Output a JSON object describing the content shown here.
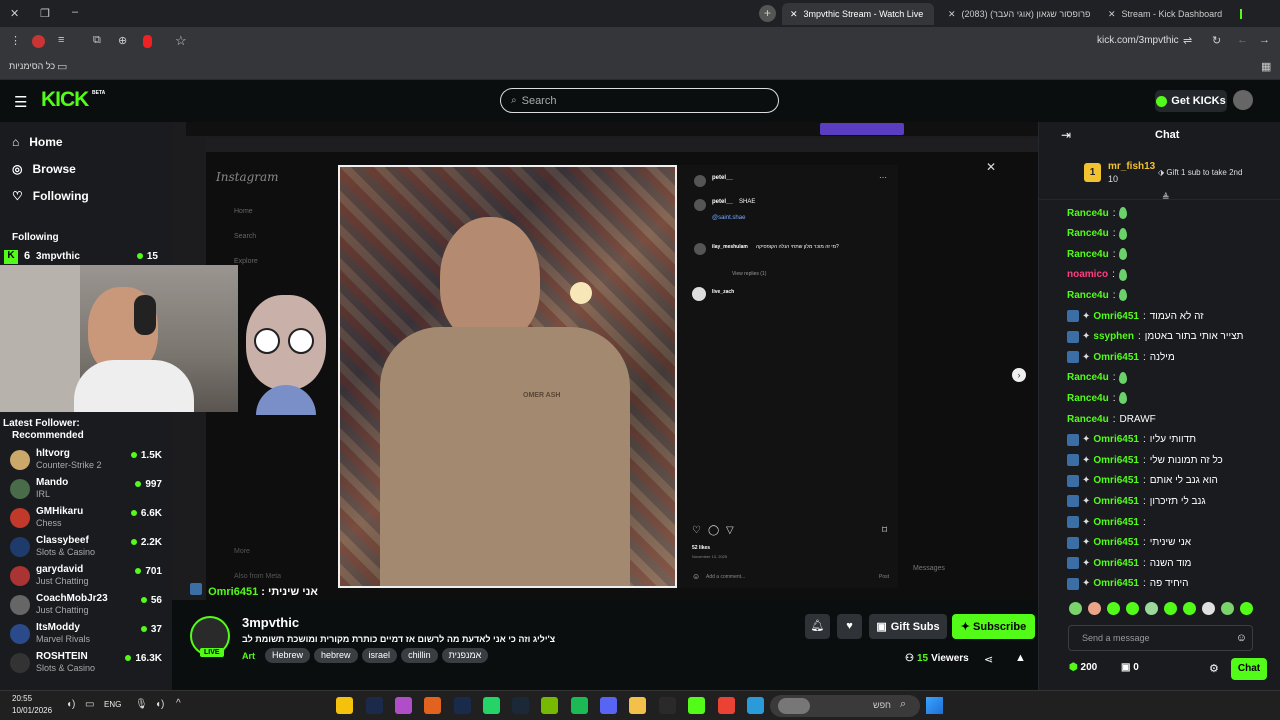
{
  "browser": {
    "tabs": [
      {
        "label": "3mpvthic Stream - Watch Live",
        "active": true
      },
      {
        "label": "פרופסור שגאון (אוגי העבר) (2083)",
        "active": false
      },
      {
        "label": "Stream - Kick Dashboard",
        "active": false
      }
    ],
    "url": "kick.com/3mpvthic",
    "bookmarks_label": "כל הסימניות"
  },
  "header": {
    "logo": "KICK",
    "logo_beta": "BETA",
    "search_placeholder": "Search",
    "get_kicks_label": "Get KICKs"
  },
  "sidebar": {
    "nav": [
      {
        "label": "Home",
        "icon": "home-icon"
      },
      {
        "label": "Browse",
        "icon": "compass-icon"
      },
      {
        "label": "Following",
        "icon": "heart-icon"
      }
    ],
    "following_heading": "Following",
    "following_channel": {
      "rank": "6",
      "name": "3mpvthic",
      "viewers": "15"
    },
    "latest_follower_label": "Latest Follower:",
    "recommended_heading": "Recommended",
    "recommended": [
      {
        "name": "hltvorg",
        "category": "Counter-Strike 2",
        "viewers": "1.5K",
        "color": "#c9a86a"
      },
      {
        "name": "Mando",
        "category": "IRL",
        "viewers": "997",
        "color": "#4a6b4a"
      },
      {
        "name": "GMHikaru",
        "category": "Chess",
        "viewers": "6.6K",
        "color": "#c0392b"
      },
      {
        "name": "Classybeef",
        "category": "Slots & Casino",
        "viewers": "2.2K",
        "color": "#1f3b6b"
      },
      {
        "name": "garydavid",
        "category": "Just Chatting",
        "viewers": "701",
        "color": "#a33"
      },
      {
        "name": "CoachMobJr23",
        "category": "Just Chatting",
        "viewers": "56",
        "color": "#666"
      },
      {
        "name": "ItsModdy",
        "category": "Marvel Rivals",
        "viewers": "37",
        "color": "#2a4a8a"
      },
      {
        "name": "ROSHTEIN",
        "category": "Slots & Casino",
        "viewers": "16.3K",
        "color": "#333"
      }
    ]
  },
  "player": {
    "overlay_chat_user": "Omri6451",
    "overlay_chat_text": "אני שיניתי",
    "instagram": {
      "brand": "Instagram",
      "left_nav": [
        "Home",
        "Search",
        "Explore",
        "More",
        "Also from Meta"
      ],
      "post_user": "petel__",
      "caption_user": "petel__",
      "caption_text": "SHAE",
      "mention": "@saint.shae",
      "comments": [
        {
          "user": "ilay_meshulam",
          "text": "מי זה מוכר מלון שתחי הנלה הקופסיקה?"
        },
        {
          "user": "live_zach",
          "text": ""
        }
      ],
      "view_replies": "View replies (1)",
      "likes": "52 likes",
      "date": "November 13, 2025",
      "add_comment": "Add a comment...",
      "post_button": "Post",
      "messages_label": "Messages",
      "shirt_text": "OMER ASH"
    }
  },
  "stream": {
    "channel": "3mpvthic",
    "live_label": "LIVE",
    "title": "צ'יליג וזה כי אני לאדעת מה לרשום אז דמיים כותרת מקורית ומושכת תשומת לב",
    "category": "Art",
    "tags": [
      "Hebrew",
      "hebrew",
      "israel",
      "chillin",
      "אמנפנית"
    ],
    "viewers": "15",
    "viewers_label": "Viewers",
    "gift_subs_label": "Gift Subs",
    "subscribe_label": "Subscribe"
  },
  "chat": {
    "title": "Chat",
    "pinned_user": "mr_fish13",
    "pinned_count": "10",
    "pinned_rank": "1",
    "gift_text": "Gift 1 sub to take 2nd",
    "messages": [
      {
        "user": "Rance4u",
        "text": "",
        "color": "#53fc18",
        "emote": true,
        "badges": false
      },
      {
        "user": "Rance4u",
        "text": "",
        "color": "#53fc18",
        "emote": true,
        "badges": false
      },
      {
        "user": "Rance4u",
        "text": "",
        "color": "#53fc18",
        "emote": true,
        "badges": false
      },
      {
        "user": "noamico",
        "text": "",
        "color": "#ff3d7f",
        "emote": true,
        "badges": false
      },
      {
        "user": "Rance4u",
        "text": "",
        "color": "#53fc18",
        "emote": true,
        "badges": false
      },
      {
        "user": "Omri6451",
        "text": "זה לא העמוד",
        "color": "#53fc18",
        "emote": false,
        "badges": true
      },
      {
        "user": "ssyphen",
        "text": "תצייר אותי בתור באטמן",
        "color": "#53fc18",
        "emote": false,
        "badges": true
      },
      {
        "user": "Omri6451",
        "text": "מילנה",
        "color": "#53fc18",
        "emote": false,
        "badges": true
      },
      {
        "user": "Rance4u",
        "text": "",
        "color": "#53fc18",
        "emote": true,
        "badges": false
      },
      {
        "user": "Rance4u",
        "text": "",
        "color": "#53fc18",
        "emote": true,
        "badges": false
      },
      {
        "user": "Rance4u",
        "text": "DRAWF",
        "color": "#53fc18",
        "emote": false,
        "badges": false
      },
      {
        "user": "Omri6451",
        "text": "תדוותי עליו",
        "color": "#53fc18",
        "emote": false,
        "badges": true
      },
      {
        "user": "Omri6451",
        "text": "כל זה תמונות שלי",
        "color": "#53fc18",
        "emote": false,
        "badges": true
      },
      {
        "user": "Omri6451",
        "text": "הוא גנב לי אותם",
        "color": "#53fc18",
        "emote": false,
        "badges": true
      },
      {
        "user": "Omri6451",
        "text": "גנב לי תזיכרון",
        "color": "#53fc18",
        "emote": false,
        "badges": true
      },
      {
        "user": "Omri6451",
        "text": "",
        "color": "#53fc18",
        "emote": false,
        "badges": true
      },
      {
        "user": "Omri6451",
        "text": "אני שיניתי",
        "color": "#53fc18",
        "emote": false,
        "badges": true
      },
      {
        "user": "Omri6451",
        "text": "מוד השנה",
        "color": "#53fc18",
        "emote": false,
        "badges": true
      },
      {
        "user": "Omri6451",
        "text": "היחיד פה",
        "color": "#53fc18",
        "emote": false,
        "badges": true
      }
    ],
    "input_placeholder": "Send a message",
    "kicks_balance": "200",
    "subs_count": "0",
    "send_label": "Chat"
  },
  "taskbar": {
    "time": "20:55",
    "date": "10/01/2026",
    "lang": "ENG",
    "search_placeholder": "חפש"
  },
  "colors": {
    "accent": "#53fc18",
    "background": "#0b0e0f",
    "panel": "#191b1f"
  }
}
